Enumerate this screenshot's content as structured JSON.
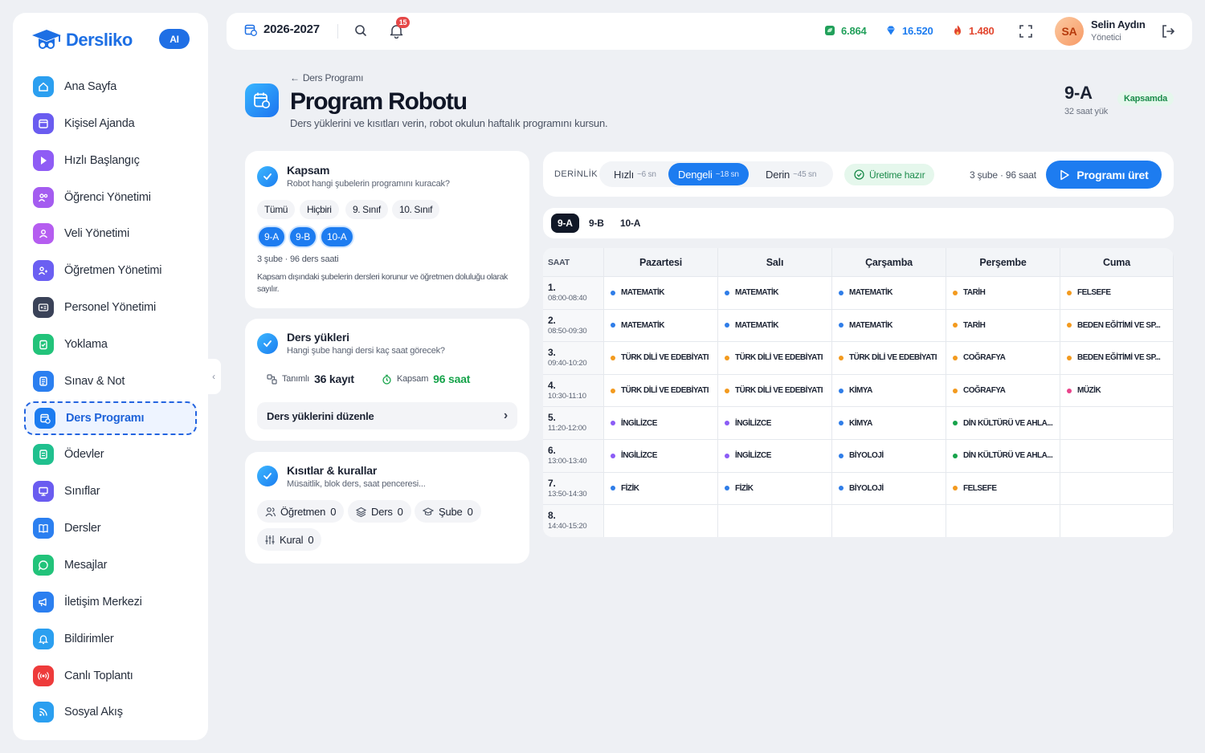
{
  "app": {
    "name": "Dersliko",
    "ai_badge": "AI"
  },
  "sidebar": {
    "items": [
      {
        "label": "Ana Sayfa",
        "icon": "home-icon",
        "color": "#2b9ff0"
      },
      {
        "label": "Kişisel Ajanda",
        "icon": "calendar-icon",
        "color": "#6a5cf0"
      },
      {
        "label": "Hızlı Başlangıç",
        "icon": "play-icon",
        "color": "#8f5cf5"
      },
      {
        "label": "Öğrenci Yönetimi",
        "icon": "students-icon",
        "color": "#a45cf0"
      },
      {
        "label": "Veli Yönetimi",
        "icon": "parents-icon",
        "color": "#b55df0"
      },
      {
        "label": "Öğretmen Yönetimi",
        "icon": "teachers-icon",
        "color": "#6b5ff2"
      },
      {
        "label": "Personel Yönetimi",
        "icon": "id-card-icon",
        "color": "#3a4258"
      },
      {
        "label": "Yoklama",
        "icon": "clipboard-check-icon",
        "color": "#22c37a"
      },
      {
        "label": "Sınav & Not",
        "icon": "exam-icon",
        "color": "#2b7ff0"
      },
      {
        "label": "Ders Programı",
        "icon": "schedule-icon",
        "color": "#1d7cf0"
      },
      {
        "label": "Ödevler",
        "icon": "homework-icon",
        "color": "#20c08e"
      },
      {
        "label": "Sınıflar",
        "icon": "classroom-icon",
        "color": "#6a5cf0"
      },
      {
        "label": "Dersler",
        "icon": "book-icon",
        "color": "#2b7ff0"
      },
      {
        "label": "Mesajlar",
        "icon": "chat-icon",
        "color": "#22c37a"
      },
      {
        "label": "İletişim Merkezi",
        "icon": "megaphone-icon",
        "color": "#2b7ff0"
      },
      {
        "label": "Bildirimler",
        "icon": "bell-icon",
        "color": "#2b9ff0"
      },
      {
        "label": "Canlı Toplantı",
        "icon": "live-icon",
        "color": "#ee3b3b"
      },
      {
        "label": "Sosyal Akış",
        "icon": "rss-icon",
        "color": "#2b9ff0"
      }
    ],
    "active_index": 9
  },
  "topbar": {
    "year": "2026-2027",
    "notification_count": "15",
    "stats": [
      {
        "value": "6.864",
        "icon": "leaf-icon",
        "color": "#22a05b"
      },
      {
        "value": "16.520",
        "icon": "gem-icon",
        "color": "#1d7cf0"
      },
      {
        "value": "1.480",
        "icon": "flame-icon",
        "color": "#e2462f"
      }
    ],
    "user": {
      "initials": "SA",
      "name": "Selin Aydın",
      "role": "Yönetici"
    }
  },
  "header": {
    "breadcrumb": "Ders Programı",
    "title": "Program Robotu",
    "subtitle": "Ders yüklerini ve kısıtları verin, robot okulun haftalık programını kursun.",
    "class_name": "9-A",
    "class_load": "32 saat yük",
    "class_status": "Kapsamda"
  },
  "scope_card": {
    "title": "Kapsam",
    "subtitle": "Robot hangi şubelerin programını kuracak?",
    "filters": [
      "Tümü",
      "Hiçbiri",
      "9. Sınıf",
      "10. Sınıf"
    ],
    "selected": [
      "9-A",
      "9-B",
      "10-A"
    ],
    "summary": "3 şube · 96 ders saati",
    "note": "Kapsam dışındaki şubelerin dersleri korunur ve öğretmen doluluğu olarak sayılır."
  },
  "load_card": {
    "title": "Ders yükleri",
    "subtitle": "Hangi şube hangi dersi kaç saat görecek?",
    "defined_label": "Tanımlı",
    "defined_value": "36 kayıt",
    "scope_label": "Kapsam",
    "scope_value": "96 saat",
    "edit_label": "Ders yüklerini düzenle"
  },
  "constraints_card": {
    "title": "Kısıtlar & kurallar",
    "subtitle": "Müsaitlik, blok ders, saat penceresi...",
    "tags": [
      {
        "label": "Öğretmen",
        "count": "0",
        "icon": "users-icon"
      },
      {
        "label": "Ders",
        "count": "0",
        "icon": "layers-icon"
      },
      {
        "label": "Şube",
        "count": "0",
        "icon": "graduation-cap-icon"
      },
      {
        "label": "Kural",
        "count": "0",
        "icon": "sliders-icon"
      }
    ]
  },
  "toolbar": {
    "depth_label": "DERİNLİK",
    "options": [
      {
        "label": "Hızlı",
        "time": "~6 sn"
      },
      {
        "label": "Dengeli",
        "time": "~18 sn"
      },
      {
        "label": "Derin",
        "time": "~45 sn"
      }
    ],
    "active_option": 1,
    "ready_label": "Üretime hazır",
    "summary": "3 şube · 96 saat",
    "generate_label": "Programı üret"
  },
  "class_tabs": [
    "9-A",
    "9-B",
    "10-A"
  ],
  "timetable": {
    "hour_header": "SAAT",
    "days": [
      "Pazartesi",
      "Salı",
      "Çarşamba",
      "Perşembe",
      "Cuma"
    ],
    "slots": [
      {
        "num": "1.",
        "time": "08:00-08:40"
      },
      {
        "num": "2.",
        "time": "08:50-09:30"
      },
      {
        "num": "3.",
        "time": "09:40-10:20"
      },
      {
        "num": "4.",
        "time": "10:30-11:10"
      },
      {
        "num": "5.",
        "time": "11:20-12:00"
      },
      {
        "num": "6.",
        "time": "13:00-13:40"
      },
      {
        "num": "7.",
        "time": "13:50-14:30"
      },
      {
        "num": "8.",
        "time": "14:40-15:20"
      }
    ],
    "colors": {
      "blue": "#2f7de8",
      "orange": "#f39a1e",
      "purple": "#8b5cf6",
      "green": "#16a34a",
      "pink": "#e9438b"
    },
    "cells": [
      [
        {
          "t": "MATEMATİK",
          "c": "blue"
        },
        {
          "t": "MATEMATİK",
          "c": "blue"
        },
        {
          "t": "MATEMATİK",
          "c": "blue"
        },
        {
          "t": "TARİH",
          "c": "orange"
        },
        {
          "t": "FELSEFE",
          "c": "orange"
        }
      ],
      [
        {
          "t": "MATEMATİK",
          "c": "blue"
        },
        {
          "t": "MATEMATİK",
          "c": "blue"
        },
        {
          "t": "MATEMATİK",
          "c": "blue"
        },
        {
          "t": "TARİH",
          "c": "orange"
        },
        {
          "t": "BEDEN EĞİTİMİ VE SP...",
          "c": "orange"
        }
      ],
      [
        {
          "t": "TÜRK DİLİ VE EDEBİYATI",
          "c": "orange"
        },
        {
          "t": "TÜRK DİLİ VE EDEBİYATI",
          "c": "orange"
        },
        {
          "t": "TÜRK DİLİ VE EDEBİYATI",
          "c": "orange"
        },
        {
          "t": "COĞRAFYA",
          "c": "orange"
        },
        {
          "t": "BEDEN EĞİTİMİ VE SP...",
          "c": "orange"
        }
      ],
      [
        {
          "t": "TÜRK DİLİ VE EDEBİYATI",
          "c": "orange"
        },
        {
          "t": "TÜRK DİLİ VE EDEBİYATI",
          "c": "orange"
        },
        {
          "t": "KİMYA",
          "c": "blue"
        },
        {
          "t": "COĞRAFYA",
          "c": "orange"
        },
        {
          "t": "MÜZİK",
          "c": "pink"
        }
      ],
      [
        {
          "t": "İNGİLİZCE",
          "c": "purple"
        },
        {
          "t": "İNGİLİZCE",
          "c": "purple"
        },
        {
          "t": "KİMYA",
          "c": "blue"
        },
        {
          "t": "DİN KÜLTÜRÜ VE AHLA...",
          "c": "green"
        },
        null
      ],
      [
        {
          "t": "İNGİLİZCE",
          "c": "purple"
        },
        {
          "t": "İNGİLİZCE",
          "c": "purple"
        },
        {
          "t": "BİYOLOJİ",
          "c": "blue"
        },
        {
          "t": "DİN KÜLTÜRÜ VE AHLA...",
          "c": "green"
        },
        null
      ],
      [
        {
          "t": "FİZİK",
          "c": "blue"
        },
        {
          "t": "FİZİK",
          "c": "blue"
        },
        {
          "t": "BİYOLOJİ",
          "c": "blue"
        },
        {
          "t": "FELSEFE",
          "c": "orange"
        },
        null
      ],
      [
        null,
        null,
        null,
        null,
        null
      ]
    ]
  }
}
